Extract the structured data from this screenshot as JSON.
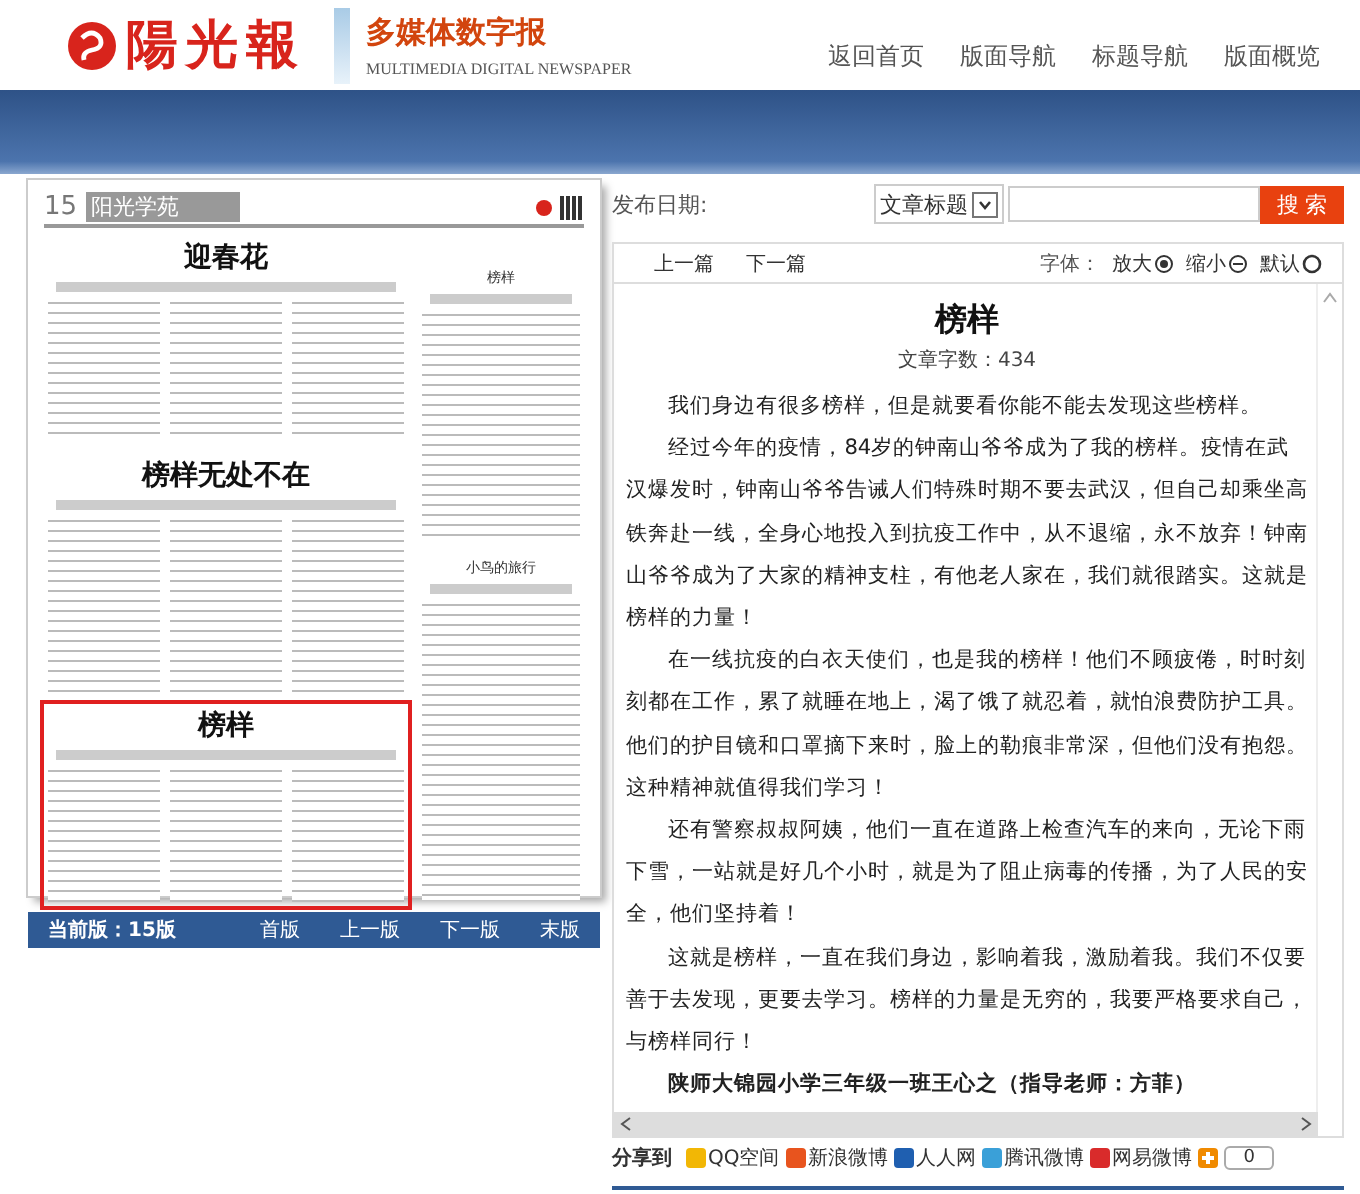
{
  "header": {
    "logo_text": "陽光報",
    "product_title": "多媒体数字报",
    "product_subtitle": "MULTIMEDIA DIGITAL NEWSPAPER",
    "nav": [
      "返回首页",
      "版面导航",
      "标题导航",
      "版面概览"
    ]
  },
  "page_preview": {
    "page_number": "15",
    "section": "阳光学苑",
    "articles": [
      {
        "title": "迎春花",
        "kind": "main",
        "selected": false
      },
      {
        "title": "榜样无处不在",
        "kind": "main",
        "selected": false
      },
      {
        "title": "榜样",
        "kind": "main",
        "selected": true
      },
      {
        "title": "榜样",
        "kind": "side",
        "selected": false
      },
      {
        "title": "小鸟的旅行",
        "kind": "side",
        "selected": false
      }
    ]
  },
  "page_nav": {
    "current": "当前版：15版",
    "links": [
      "首版",
      "上一版",
      "下一版",
      "末版"
    ]
  },
  "search": {
    "label": "发布日期:",
    "field_type": "文章标题",
    "button": "搜 索"
  },
  "article_toolbar": {
    "links": [
      "上一篇",
      "下一篇"
    ],
    "font_label": "字体：",
    "font_options": [
      {
        "label": "放大",
        "kind": "enlarge"
      },
      {
        "label": "缩小",
        "kind": "shrink"
      },
      {
        "label": "默认",
        "kind": "default"
      }
    ]
  },
  "article": {
    "title": "榜样",
    "word_count": "文章字数：434",
    "paragraphs": [
      "我们身边有很多榜样，但是就要看你能不能去发现这些榜样。",
      "经过今年的疫情，84岁的钟南山爷爷成为了我的榜样。疫情在武汉爆发时，钟南山爷爷告诫人们特殊时期不要去武汉，但自己却乘坐高铁奔赴一线，全身心地投入到抗疫工作中，从不退缩，永不放弃！钟南山爷爷成为了大家的精神支柱，有他老人家在，我们就很踏实。这就是榜样的力量！",
      "在一线抗疫的白衣天使们，也是我的榜样！他们不顾疲倦，时时刻刻都在工作，累了就睡在地上，渴了饿了就忍着，就怕浪费防护工具。他们的护目镜和口罩摘下来时，脸上的勒痕非常深，但他们没有抱怨。这种精神就值得我们学习！",
      "还有警察叔叔阿姨，他们一直在道路上检查汽车的来向，无论下雨下雪，一站就是好几个小时，就是为了阻止病毒的传播，为了人民的安全，他们坚持着！",
      "这就是榜样，一直在我们身边，影响着我，激励着我。我们不仅要善于去发现，更要去学习。榜样的力量是无穷的，我要严格要求自己，与榜样同行！"
    ],
    "signature": "陕师大锦园小学三年级一班王心之（指导老师：方菲）"
  },
  "share": {
    "label": "分享到",
    "sites": [
      {
        "label": "QQ空间",
        "color": "#f2b705"
      },
      {
        "label": "新浪微博",
        "color": "#e8541e"
      },
      {
        "label": "人人网",
        "color": "#1f5fb0"
      },
      {
        "label": "腾讯微博",
        "color": "#3aa0d8"
      },
      {
        "label": "网易微博",
        "color": "#d92b2b"
      }
    ],
    "count": "0"
  }
}
